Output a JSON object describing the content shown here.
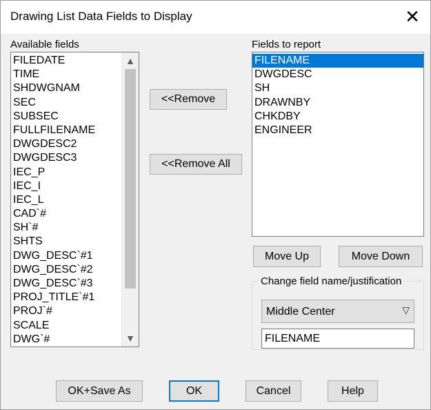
{
  "window": {
    "title": "Drawing List Data Fields to Display",
    "close_glyph": "✕"
  },
  "available": {
    "label": "Available fields",
    "items": [
      "FILEDATE",
      "TIME",
      "SHDWGNAM",
      "SEC",
      "SUBSEC",
      "FULLFILENAME",
      "DWGDESC2",
      "DWGDESC3",
      "IEC_P",
      "IEC_I",
      "IEC_L",
      "CAD`#",
      "SH`#",
      "SHTS",
      "DWG_DESC`#1",
      "DWG_DESC`#2",
      "DWG_DESC`#3",
      "PROJ_TITLE`#1",
      "PROJ`#",
      "SCALE",
      "DWG`#"
    ],
    "scroll_up_glyph": "▲",
    "scroll_down_glyph": "▼"
  },
  "middle": {
    "remove_label": "<<Remove",
    "remove_all_label": "<<Remove All"
  },
  "report": {
    "label": "Fields to report",
    "items": [
      "FILENAME",
      "DWGDESC",
      "SH",
      "DRAWNBY",
      "CHKDBY",
      "ENGINEER"
    ],
    "selected_index": 0,
    "move_up_label": "Move Up",
    "move_down_label": "Move Down"
  },
  "change_group": {
    "label": "Change field name/justification",
    "justification_value": "Middle Center",
    "dropdown_glyph": "▽",
    "field_name_value": "FILENAME"
  },
  "footer": {
    "ok_save_as_label": "OK+Save As",
    "ok_label": "OK",
    "cancel_label": "Cancel",
    "help_label": "Help"
  },
  "colors": {
    "selection": "#0078d7",
    "default_button_border": "#0078d7"
  }
}
